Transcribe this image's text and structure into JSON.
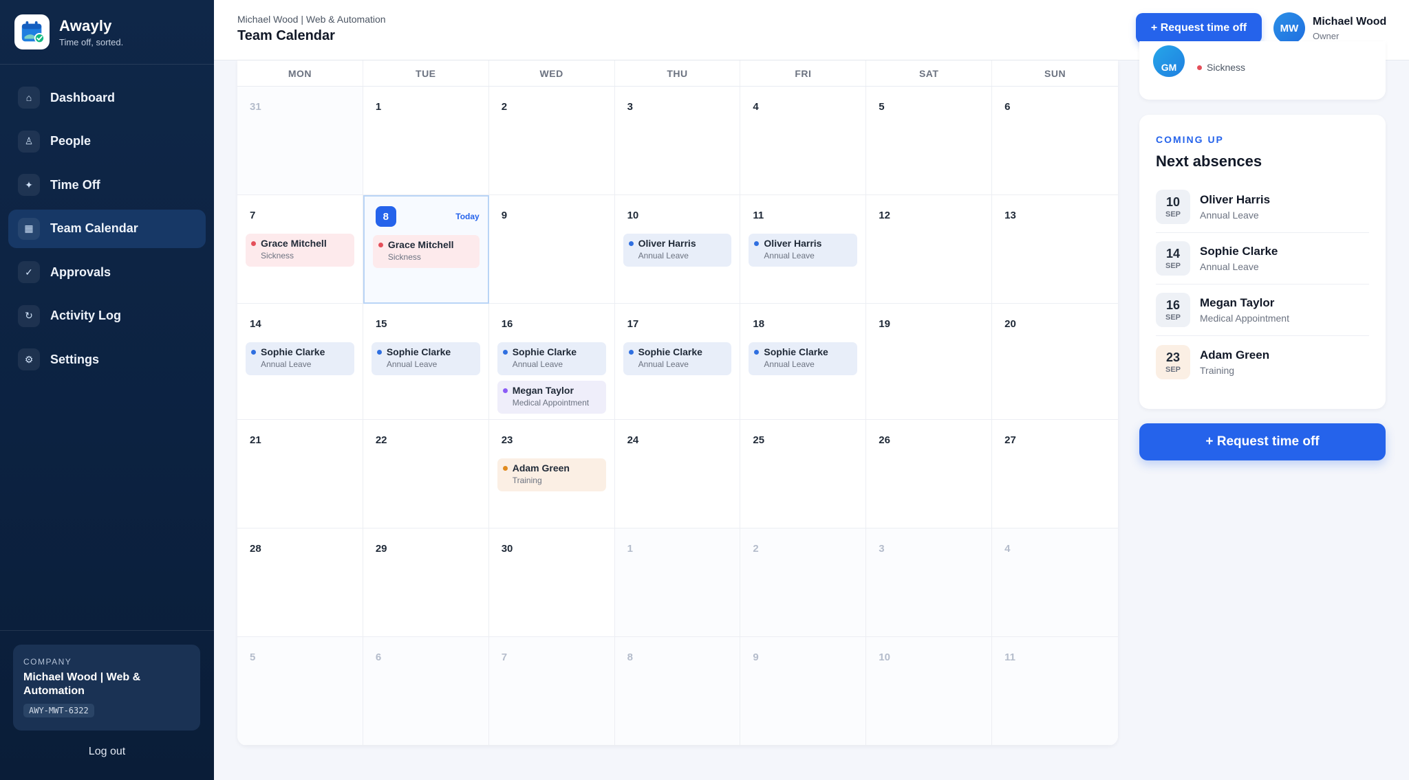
{
  "app": {
    "name": "Awayly",
    "tagline": "Time off, sorted."
  },
  "nav": {
    "items": [
      {
        "label": "Dashboard",
        "icon": "home-icon"
      },
      {
        "label": "People",
        "icon": "people-icon"
      },
      {
        "label": "Time Off",
        "icon": "sparkle-icon"
      },
      {
        "label": "Team Calendar",
        "icon": "calendar-icon",
        "active": true
      },
      {
        "label": "Approvals",
        "icon": "check-icon"
      },
      {
        "label": "Activity Log",
        "icon": "history-icon"
      },
      {
        "label": "Settings",
        "icon": "gear-icon"
      }
    ]
  },
  "company": {
    "label": "COMPANY",
    "name": "Michael Wood | Web & Automation",
    "code": "AWY-MWT-6322"
  },
  "logout_label": "Log out",
  "header": {
    "breadcrumb": "Michael Wood | Web & Automation",
    "title": "Team Calendar",
    "request_button": "+ Request time off",
    "user": {
      "initials": "MW",
      "name": "Michael Wood",
      "role": "Owner"
    }
  },
  "calendar": {
    "weekdays": [
      "MON",
      "TUE",
      "WED",
      "THU",
      "FRI",
      "SAT",
      "SUN"
    ],
    "today_label": "Today",
    "colors": {
      "sick": "#e44f5a",
      "annual": "#2f6fe0",
      "medical": "#8b5cf6",
      "training": "#e08a1e"
    },
    "days": [
      {
        "n": "31",
        "out": true,
        "events": []
      },
      {
        "n": "1",
        "events": []
      },
      {
        "n": "2",
        "events": []
      },
      {
        "n": "3",
        "events": []
      },
      {
        "n": "4",
        "events": []
      },
      {
        "n": "5",
        "events": []
      },
      {
        "n": "6",
        "events": []
      },
      {
        "n": "7",
        "events": [
          {
            "name": "Grace Mitchell",
            "type": "Sickness",
            "kind": "sick"
          }
        ]
      },
      {
        "n": "8",
        "today": true,
        "events": [
          {
            "name": "Grace Mitchell",
            "type": "Sickness",
            "kind": "sick"
          }
        ]
      },
      {
        "n": "9",
        "events": []
      },
      {
        "n": "10",
        "events": [
          {
            "name": "Oliver Harris",
            "type": "Annual Leave",
            "kind": "annual"
          }
        ]
      },
      {
        "n": "11",
        "events": [
          {
            "name": "Oliver Harris",
            "type": "Annual Leave",
            "kind": "annual"
          }
        ]
      },
      {
        "n": "12",
        "events": []
      },
      {
        "n": "13",
        "events": []
      },
      {
        "n": "14",
        "events": [
          {
            "name": "Sophie Clarke",
            "type": "Annual Leave",
            "kind": "annual"
          }
        ]
      },
      {
        "n": "15",
        "events": [
          {
            "name": "Sophie Clarke",
            "type": "Annual Leave",
            "kind": "annual"
          }
        ]
      },
      {
        "n": "16",
        "events": [
          {
            "name": "Sophie Clarke",
            "type": "Annual Leave",
            "kind": "annual"
          },
          {
            "name": "Megan Taylor",
            "type": "Medical Appointment",
            "kind": "medical"
          }
        ]
      },
      {
        "n": "17",
        "events": [
          {
            "name": "Sophie Clarke",
            "type": "Annual Leave",
            "kind": "annual"
          }
        ]
      },
      {
        "n": "18",
        "events": [
          {
            "name": "Sophie Clarke",
            "type": "Annual Leave",
            "kind": "annual"
          }
        ]
      },
      {
        "n": "19",
        "events": []
      },
      {
        "n": "20",
        "events": []
      },
      {
        "n": "21",
        "events": []
      },
      {
        "n": "22",
        "events": []
      },
      {
        "n": "23",
        "events": [
          {
            "name": "Adam Green",
            "type": "Training",
            "kind": "training"
          }
        ]
      },
      {
        "n": "24",
        "events": []
      },
      {
        "n": "25",
        "events": []
      },
      {
        "n": "26",
        "events": []
      },
      {
        "n": "27",
        "events": []
      },
      {
        "n": "28",
        "events": []
      },
      {
        "n": "29",
        "events": []
      },
      {
        "n": "30",
        "events": []
      },
      {
        "n": "1",
        "out": true,
        "events": []
      },
      {
        "n": "2",
        "out": true,
        "events": []
      },
      {
        "n": "3",
        "out": true,
        "events": []
      },
      {
        "n": "4",
        "out": true,
        "events": []
      },
      {
        "n": "5",
        "out": true,
        "events": []
      },
      {
        "n": "6",
        "out": true,
        "events": []
      },
      {
        "n": "7",
        "out": true,
        "events": []
      },
      {
        "n": "8",
        "out": true,
        "events": []
      },
      {
        "n": "9",
        "out": true,
        "events": []
      },
      {
        "n": "10",
        "out": true,
        "events": []
      },
      {
        "n": "11",
        "out": true,
        "events": []
      }
    ]
  },
  "panel": {
    "top_card": {
      "avatar_initials": "GM",
      "status": "Sickness"
    },
    "kicker": "COMING UP",
    "title": "Next absences",
    "absences": [
      {
        "day": "10",
        "month": "SEP",
        "name": "Oliver Harris",
        "type": "Annual Leave",
        "tone": "cool"
      },
      {
        "day": "14",
        "month": "SEP",
        "name": "Sophie Clarke",
        "type": "Annual Leave",
        "tone": "cool"
      },
      {
        "day": "16",
        "month": "SEP",
        "name": "Megan Taylor",
        "type": "Medical Appointment",
        "tone": "cool"
      },
      {
        "day": "23",
        "month": "SEP",
        "name": "Adam Green",
        "type": "Training",
        "tone": "warm"
      }
    ],
    "request_button": "+ Request time off"
  }
}
